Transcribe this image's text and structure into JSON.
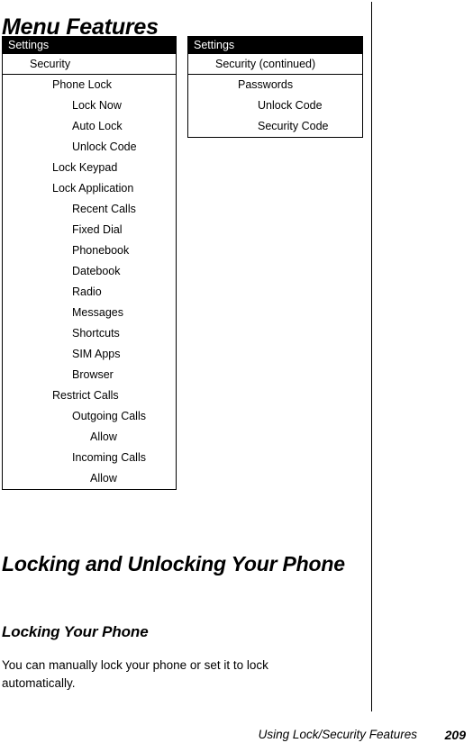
{
  "document": {
    "page_title": "Menu Features"
  },
  "menu_tables": [
    {
      "id": "settings-security",
      "header": "Settings",
      "rows": [
        {
          "label": "Security",
          "level": 1,
          "divider": true
        },
        {
          "label": "Phone Lock",
          "level": 2,
          "divider": false
        },
        {
          "label": "Lock Now",
          "level": 3,
          "divider": false
        },
        {
          "label": "Auto Lock",
          "level": 3,
          "divider": false
        },
        {
          "label": "Unlock Code",
          "level": 3,
          "divider": false
        },
        {
          "label": "Lock Keypad",
          "level": 2,
          "divider": false
        },
        {
          "label": "Lock Application",
          "level": 2,
          "divider": false
        },
        {
          "label": "Recent Calls",
          "level": 3,
          "divider": false
        },
        {
          "label": "Fixed Dial",
          "level": 3,
          "divider": false
        },
        {
          "label": "Phonebook",
          "level": 3,
          "divider": false
        },
        {
          "label": "Datebook",
          "level": 3,
          "divider": false
        },
        {
          "label": "Radio",
          "level": 3,
          "divider": false
        },
        {
          "label": "Messages",
          "level": 3,
          "divider": false
        },
        {
          "label": "Shortcuts",
          "level": 3,
          "divider": false
        },
        {
          "label": "SIM Apps",
          "level": 3,
          "divider": false
        },
        {
          "label": "Browser",
          "level": 3,
          "divider": false
        },
        {
          "label": "Restrict Calls",
          "level": 2,
          "divider": false
        },
        {
          "label": "Outgoing Calls",
          "level": 3,
          "divider": false
        },
        {
          "label": "Allow",
          "level": 4,
          "divider": false
        },
        {
          "label": "Incoming Calls",
          "level": 3,
          "divider": false
        },
        {
          "label": "Allow",
          "level": 4,
          "divider": false
        }
      ]
    },
    {
      "id": "settings-security-continued",
      "header": "Settings",
      "rows": [
        {
          "label": "Security (continued)",
          "level": 1,
          "divider": true
        },
        {
          "label": "Passwords",
          "level": 2,
          "divider": false
        },
        {
          "label": "Unlock Code",
          "level": 3,
          "divider": false
        },
        {
          "label": "Security Code",
          "level": 3,
          "divider": false
        }
      ]
    }
  ],
  "sections": {
    "heading_1": "Locking and Unlocking Your Phone",
    "heading_2": "Locking Your Phone",
    "body": "You can manually lock your phone or set it to lock automatically."
  },
  "footer": {
    "running_title": "Using Lock/Security Features",
    "page_number": "209"
  },
  "colors": {
    "text": "#000000",
    "page_background": "#ffffff",
    "table_header_background": "#000000",
    "table_header_text": "#ffffff",
    "rule": "#000000"
  }
}
